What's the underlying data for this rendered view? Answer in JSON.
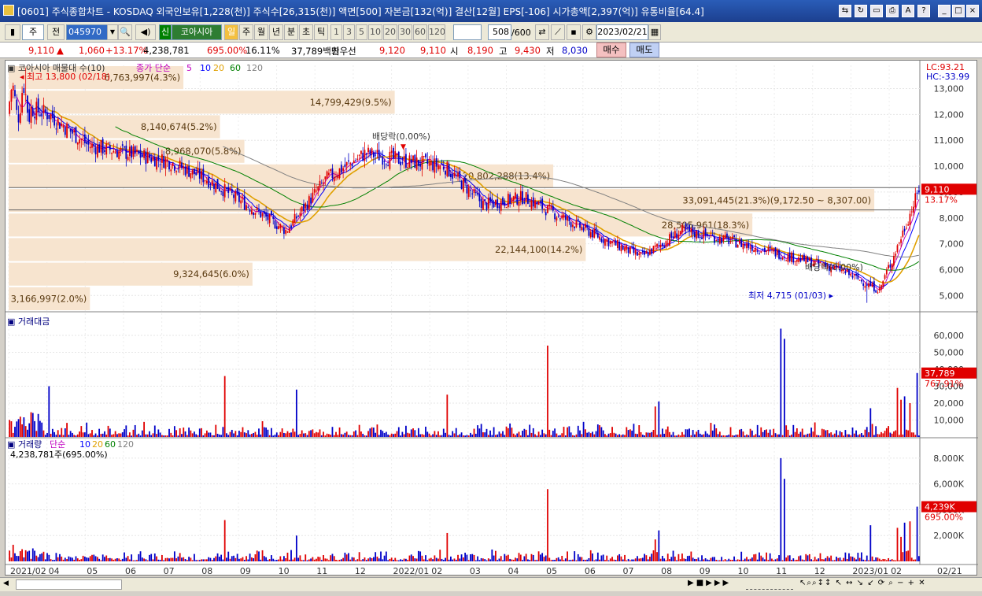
{
  "window": {
    "title": "[0601] 주식종합차트 - KOSDAQ 외국인보유[1,228(천)] 주식수[26,315(천)] 액면[500] 자본금[132(억)] 결산[12월] EPS[-106] 시가총액[2,397(억)] 유통비율[64.4]"
  },
  "toolbar": {
    "type_sel": "주",
    "prev": "전",
    "code": "045970",
    "credit": "신",
    "name": "코아시아",
    "periods": [
      "일",
      "주",
      "월",
      "년",
      "분",
      "초",
      "틱"
    ],
    "active_period": "일",
    "ticks": [
      "1",
      "3",
      "5",
      "10",
      "20",
      "30",
      "60",
      "120"
    ],
    "count": "508",
    "count_total": "/600",
    "date": "2023/02/21"
  },
  "quote": {
    "price": "9,110",
    "change": "1,060",
    "change_pct": "+13.17%",
    "volume": "4,238,781",
    "vol_ratio": "695.00%",
    "turnover": "16.11%",
    "amount": "37,789백만",
    "best_label": "최우선",
    "ask": "9,120",
    "bid": "9,110",
    "open_label": "시",
    "open": "8,190",
    "high_label": "고",
    "high": "9,430",
    "low_label": "저",
    "low": "8,030",
    "buy": "매수",
    "sell": "매도"
  },
  "panels": {
    "price_legend_name": "코아시아 매물대 수(10)",
    "price_legend_ma": "종가 단순",
    "ma_periods": [
      "5",
      "10",
      "20",
      "60",
      "120"
    ],
    "lc": "LC:93.21",
    "hc": "HC:-33.99",
    "high_mark": "최고 13,800 (02/18)",
    "low_mark": "최저 4,715 (01/03)",
    "div1": "배당락(0.00%)",
    "div2": "배당락(0.00%)",
    "price_last": "9,110",
    "price_last_pct": "13.17%",
    "amount_title": "거래대금",
    "amount_last": "37,789",
    "amount_last_pct": "767.91%",
    "volume_title": "거래량",
    "volume_ma": "단순",
    "volume_sub": "4,238,781주(695.00%)",
    "volume_last": "4,239K",
    "volume_last_pct": "695.00%"
  },
  "volume_profile": [
    {
      "label": "3,166,997(2.0%)"
    },
    {
      "label": "9,324,645(6.0%)"
    },
    {
      "label": "22,144,100(14.2%)"
    },
    {
      "label": "28,505,961(18.3%)"
    },
    {
      "label": "33,091,445(21.3%)(9,172.50 ~ 8,307.00)"
    },
    {
      "label": "20,802,288(13.4%)"
    },
    {
      "label": "8,968,070(5.8%)"
    },
    {
      "label": "8,140,674(5.2%)"
    },
    {
      "label": "14,799,429(9.5%)"
    },
    {
      "label": "6,763,997(4.3%)"
    }
  ],
  "chart_data": [
    {
      "type": "candlestick",
      "title": "코아시아 매물대 수(10)",
      "x": [
        "2021/02",
        "04",
        "05",
        "06",
        "07",
        "08",
        "09",
        "10",
        "11",
        "12",
        "2022/01",
        "02",
        "03",
        "04",
        "05",
        "06",
        "07",
        "08",
        "09",
        "10",
        "11",
        "12",
        "2023/01",
        "02"
      ],
      "close_approx": [
        12500,
        12000,
        10800,
        10500,
        10200,
        9500,
        8500,
        7500,
        9500,
        10500,
        10200,
        10000,
        8500,
        8800,
        8000,
        7200,
        6500,
        7500,
        7200,
        6800,
        6400,
        6000,
        5200,
        9110
      ],
      "y_ticks": [
        "13,000",
        "12,000",
        "11,000",
        "10,000",
        "9,000",
        "8,000",
        "7,000",
        "6,000",
        "5,000"
      ],
      "ylim": [
        4400,
        13900
      ]
    },
    {
      "type": "bar",
      "title": "거래대금",
      "y_ticks": [
        "60,000",
        "50,000",
        "40,000",
        "30,000",
        "20,000",
        "10,000"
      ],
      "ylim": [
        0,
        67000
      ]
    },
    {
      "type": "bar",
      "title": "거래량",
      "y_ticks": [
        "8,000K",
        "6,000K",
        "4,000K",
        "2,000K"
      ],
      "ylim": [
        0,
        8300
      ]
    }
  ],
  "x_last_label": "02/21",
  "colors": {
    "up": "#e00000",
    "down": "#0000c8",
    "ma5": "#c000c0",
    "ma10": "#0000ff",
    "ma20": "#e0a000",
    "ma60": "#008000",
    "ma120": "#808080",
    "profile": "#f7e4cf"
  }
}
